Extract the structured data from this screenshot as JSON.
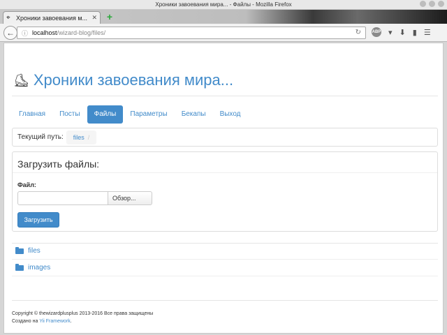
{
  "window": {
    "title": "Хроники завоевания мира... - Файлы - Mozilla Firefox"
  },
  "browser": {
    "tab_title": "Хроники завоевания м...",
    "tab_close": "✕",
    "new_tab": "+",
    "url_host": "localhost",
    "url_path": "/wizard-blog/files/",
    "abp_label": "ABP"
  },
  "site": {
    "title": "Хроники завоевания мира...",
    "nav": [
      {
        "label": "Главная",
        "active": false
      },
      {
        "label": "Посты",
        "active": false
      },
      {
        "label": "Файлы",
        "active": true
      },
      {
        "label": "Параметры",
        "active": false
      },
      {
        "label": "Бекапы",
        "active": false
      },
      {
        "label": "Выход",
        "active": false
      }
    ],
    "breadcrumb": {
      "label": "Текущий путь:",
      "items": [
        "files"
      ],
      "separator": "/"
    }
  },
  "upload": {
    "title": "Загрузить файлы:",
    "file_label": "Файл:",
    "browse_label": "Обзор...",
    "submit_label": "Загрузить"
  },
  "files": [
    {
      "name": "files",
      "icon": "folder-open-icon"
    },
    {
      "name": "images",
      "icon": "folder-open-icon"
    }
  ],
  "footer": {
    "copyright": "Copyright © thewizardplusplus 2013-2016 Все права защищены",
    "created_prefix": "Создано на",
    "framework": "Yii Framework",
    "suffix": "."
  },
  "colors": {
    "accent": "#428bca",
    "active_pill": "#428bca"
  }
}
